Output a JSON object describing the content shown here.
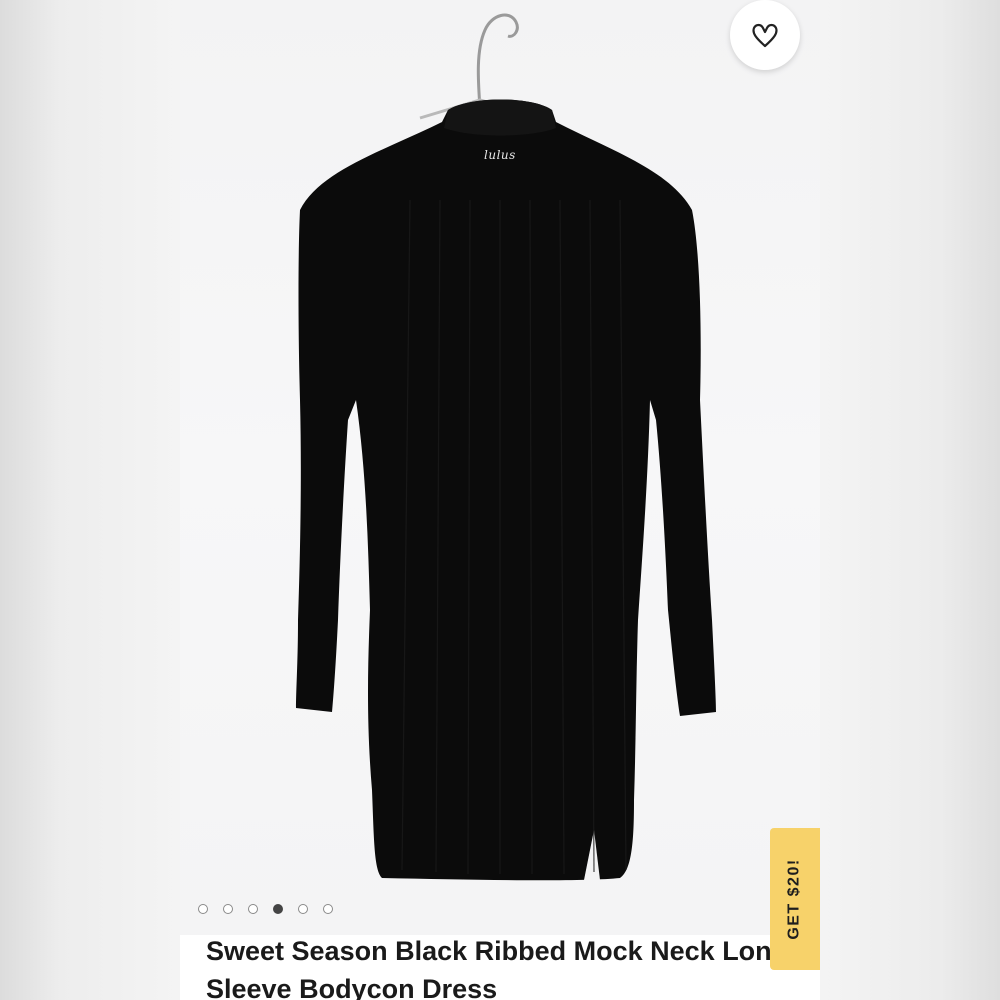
{
  "product": {
    "title": "Sweet Season Black Ribbed Mock Neck Long Sleeve Bodycon Dress",
    "brand_tag": "lulus"
  },
  "gallery": {
    "image_count": 6,
    "active_index": 3
  },
  "promo": {
    "label": "GET $20!"
  },
  "icons": {
    "favorite": "heart-icon"
  },
  "colors": {
    "promo_background": "#f7d26a",
    "dress": "#0b0b0b",
    "title_text": "#1a1a1a"
  }
}
